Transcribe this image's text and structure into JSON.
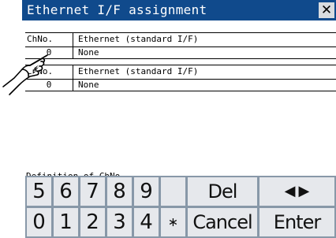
{
  "window": {
    "title": "Ethernet I/F assignment",
    "close_glyph": "✕"
  },
  "table1": {
    "headers": [
      "ChNo.",
      "Ethernet (standard I/F)"
    ],
    "rows": [
      {
        "ch": "0",
        "value": "None"
      }
    ]
  },
  "table2": {
    "headers": [
      "ChNo.",
      "Ethernet (standard I/F)"
    ],
    "rows": [
      {
        "ch": "0",
        "value": "None"
      }
    ]
  },
  "definition_label": "Definition of ChNo.",
  "keypad": {
    "row1": [
      "5",
      "6",
      "7",
      "8",
      "9",
      "",
      "Del"
    ],
    "row1_arrows": [
      "◀",
      "▶"
    ],
    "row2": [
      "0",
      "1",
      "2",
      "3",
      "4",
      "∗",
      "Cancel",
      "Enter"
    ]
  },
  "colors": {
    "title_bar": "#104a8c",
    "keypad_background": "#8898a8",
    "key_face": "#e6e8ec"
  },
  "icons": {
    "pointer": "touch-hand-icon"
  }
}
